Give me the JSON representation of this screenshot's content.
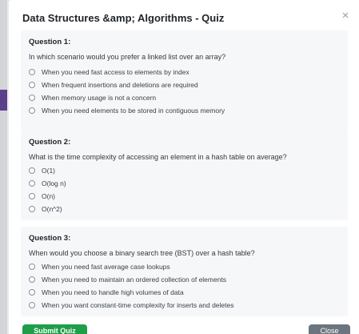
{
  "modal": {
    "title": "Data Structures &amp; Algorithms - Quiz",
    "close_icon": "×"
  },
  "questions": [
    {
      "title": "Question 1:",
      "text": "In which scenario would you prefer a linked list over an array?",
      "options": [
        "When you need fast access to elements by index",
        "When frequent insertions and deletions are required",
        "When memory usage is not a concern",
        "When you need elements to be stored in contiguous memory"
      ]
    },
    {
      "title": "Question 2:",
      "text": "What is the time complexity of accessing an element in a hash table on average?",
      "options": [
        "O(1)",
        "O(log n)",
        "O(n)",
        "O(n^2)"
      ]
    },
    {
      "title": "Question 3:",
      "text": "When would you choose a binary search tree (BST) over a hash table?",
      "options": [
        "When you need fast average case lookups",
        "When you need to maintain an ordered collection of elements",
        "When you need to handle high volumes of data",
        "When you want constant-time complexity for inserts and deletes"
      ]
    }
  ],
  "footer": {
    "submit_label": "Submit Quiz",
    "close_label": "Close"
  },
  "colors": {
    "submit": "#1e9e48",
    "close": "#6c757d",
    "card": "#f6f7f9"
  }
}
